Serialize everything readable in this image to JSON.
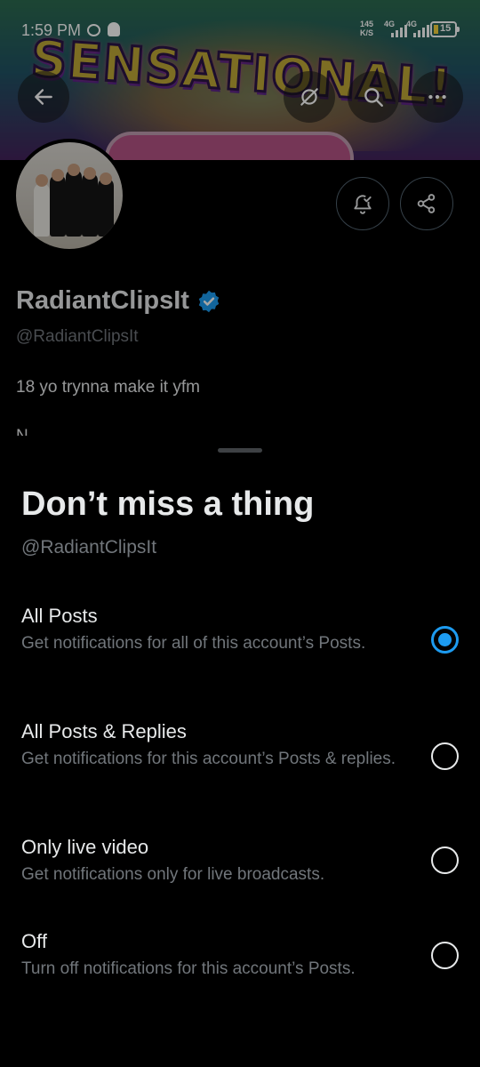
{
  "status_bar": {
    "time": "1:59 PM",
    "net_speed_value": "145",
    "net_speed_unit": "K/S",
    "signal1_label": "4G",
    "signal2_label": "4G",
    "battery": "15"
  },
  "banner": {
    "text": "SENSATIONAL!"
  },
  "profile": {
    "name": "RadiantClipsIt",
    "handle": "@RadiantClipsIt",
    "bio": "18 yo trynna make it yfm",
    "bio_more": "N"
  },
  "sheet": {
    "title": "Don’t miss a thing",
    "handle": "@RadiantClipsIt",
    "options": [
      {
        "label": "All Posts",
        "description": "Get notifications for all of this account’s Posts.",
        "selected": true
      },
      {
        "label": "All Posts & Replies",
        "description": "Get notifications for this account’s Posts & replies.",
        "selected": false
      },
      {
        "label": "Only live video",
        "description": "Get notifications only for live broadcasts.",
        "selected": false
      },
      {
        "label": "Off",
        "description": "Turn off notifications for this account’s Posts.",
        "selected": false
      }
    ]
  },
  "colors": {
    "accent": "#1d9bf0",
    "muted": "#71767b",
    "text": "#e7e9ea"
  },
  "icons": [
    "back-arrow-icon",
    "hide-icon",
    "search-icon",
    "more-icon",
    "notification-settings-icon",
    "share-icon",
    "verified-badge-icon"
  ]
}
